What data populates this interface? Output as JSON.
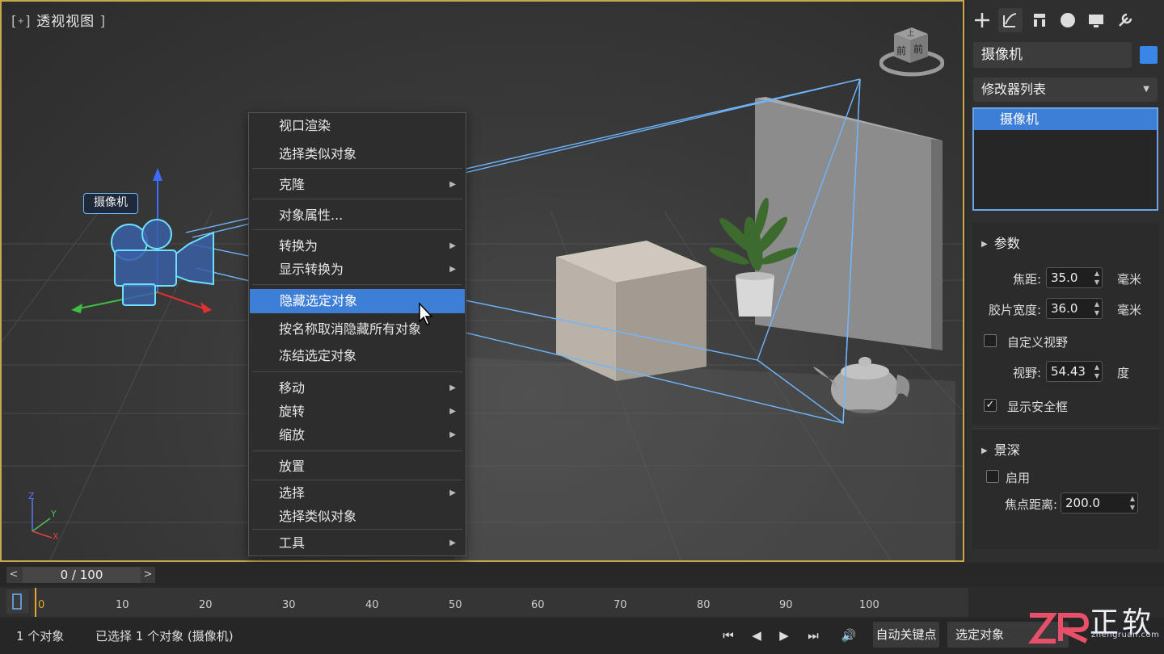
{
  "viewport": {
    "title_open": "[",
    "title_mark": "+",
    "title": "透视视图",
    "title_close": "]",
    "camera_tag": "摄像机",
    "viewcube": {
      "top": "上",
      "front": "前",
      "right": "前"
    },
    "axis": {
      "z": "Z",
      "y": "Y",
      "x": "X"
    }
  },
  "context_menu": {
    "items": [
      {
        "label": "视口渲染",
        "submenu": false
      },
      {
        "label": "选择类似对象",
        "submenu": false
      },
      {
        "label": "克隆",
        "submenu": true
      },
      {
        "label": "对象属性...",
        "submenu": false
      },
      {
        "label": "转换为",
        "submenu": true
      },
      {
        "label": "显示转换为",
        "submenu": true
      },
      {
        "label": "隐藏选定对象",
        "submenu": false,
        "highlighted": true
      },
      {
        "label": "按名称取消隐藏所有对象",
        "submenu": false
      },
      {
        "label": "冻结选定对象",
        "submenu": false
      },
      {
        "label": "移动",
        "submenu": true
      },
      {
        "label": "旋转",
        "submenu": true
      },
      {
        "label": "缩放",
        "submenu": true
      },
      {
        "label": "放置",
        "submenu": false
      },
      {
        "label": "选择",
        "submenu": true
      },
      {
        "label": "选择类似对象",
        "submenu": false
      },
      {
        "label": "工具",
        "submenu": true
      }
    ],
    "arrow_glyph": "▶"
  },
  "panel": {
    "tabs": [
      "create-icon",
      "modify-icon",
      "hierarchy-icon",
      "motion-icon",
      "display-icon",
      "utilities-icon"
    ],
    "object_name": "摄像机",
    "object_color": "#3a86e8",
    "modifier_list": "修改器列表",
    "stack_item": "摄像机",
    "params": {
      "title": "参数",
      "focal_length_label": "焦距:",
      "focal_length": "35.0",
      "focal_length_unit": "毫米",
      "film_width_label": "胶片宽度:",
      "film_width": "36.0",
      "film_width_unit": "毫米",
      "custom_fov_label": "自定义视野",
      "custom_fov_checked": false,
      "fov_label": "视野:",
      "fov": "54.43",
      "fov_unit": "度",
      "safe_frame_label": "显示安全框",
      "safe_frame_checked": true
    },
    "dof": {
      "title": "景深",
      "enable_label": "启用",
      "enable_checked": false,
      "focus_distance_label": "焦点距离:",
      "focus_distance": "200.0"
    },
    "check_glyph": "✓",
    "spin_glyph": "▲▼",
    "dropdown_glyph": "▼",
    "rollout_glyph": "▶"
  },
  "timeline": {
    "slider_label": "0 / 100",
    "prev": "<",
    "next": ">",
    "ticks": [
      "0",
      "10",
      "20",
      "30",
      "40",
      "50",
      "60",
      "70",
      "80",
      "90",
      "100"
    ]
  },
  "status": {
    "object_count": "1 个对象",
    "selection": "已选择 1 个对象 (摄像机)",
    "playback": {
      "first": "⏮",
      "prev": "◀",
      "play": "▶",
      "last": "⏭",
      "sound": "🔊"
    },
    "auto_key": "自动关键点",
    "selection_set": "选定对象"
  },
  "logo": {
    "brand": "正软",
    "url": "zhengruan.com"
  }
}
